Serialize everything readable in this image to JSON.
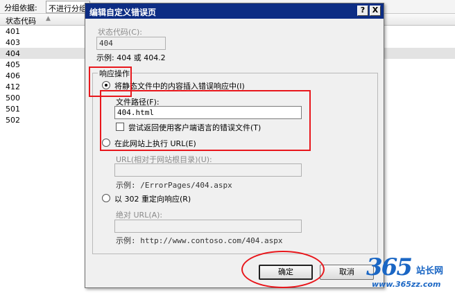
{
  "background": {
    "group_label": "分组依据:",
    "group_value": "不进行分组",
    "column_header": "状态代码",
    "rows": [
      "401",
      "403",
      "404",
      "405",
      "406",
      "412",
      "500",
      "501",
      "502"
    ],
    "selected_row": "404"
  },
  "dialog": {
    "title": "编辑自定义错误页",
    "help_btn": "?",
    "close_btn": "X",
    "status_code_label": "状态代码(C):",
    "status_code_value": "404",
    "example1": "示例: 404 或 404.2",
    "group_title": "响应操作",
    "radio1_label": "将静态文件中的内容插入错误响应中(I)",
    "file_path_label": "文件路径(F):",
    "file_path_value": "404.html",
    "checkbox_label": "尝试返回使用客户端语言的错误文件(T)",
    "radio2_label": "在此网站上执行 URL(E)",
    "url_relative_label": "URL(相对于网站根目录)(U):",
    "example2": "示例: /ErrorPages/404.aspx",
    "radio3_label": "以 302 重定向响应(R)",
    "absolute_url_label": "绝对 URL(A):",
    "example3": "示例: http://www.contoso.com/404.aspx",
    "ok_label": "确定",
    "cancel_label": "取消"
  },
  "watermark": {
    "number": "365",
    "site_name": "站长网",
    "url": "www.365zz.com"
  },
  "colors": {
    "titlebar": "#0d2d84",
    "annotation": "#e8161b",
    "watermark": "#1a66c4"
  }
}
